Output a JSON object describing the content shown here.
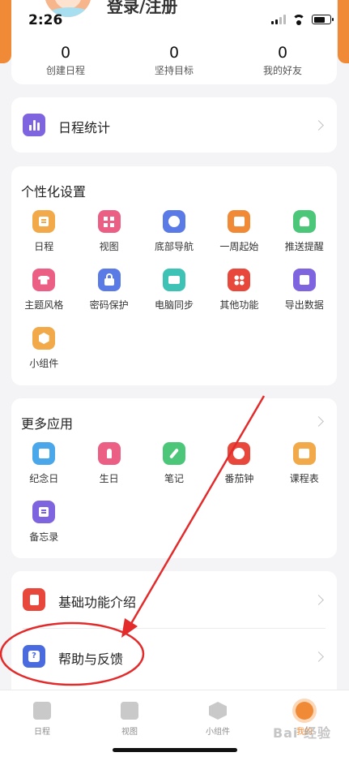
{
  "status": {
    "time": "2:26"
  },
  "profile": {
    "login_label": "登录/注册"
  },
  "stats": [
    {
      "value": "0",
      "label": "创建日程"
    },
    {
      "value": "0",
      "label": "坚持目标"
    },
    {
      "value": "0",
      "label": "我的好友"
    }
  ],
  "schedule_stats": {
    "label": "日程统计"
  },
  "personal": {
    "title": "个性化设置",
    "items": [
      {
        "label": "日程",
        "icon": "schedule-icon",
        "color": "#f2a94a"
      },
      {
        "label": "视图",
        "icon": "grid-icon",
        "color": "#ec5f84"
      },
      {
        "label": "底部导航",
        "icon": "compass-icon",
        "color": "#5a7be6"
      },
      {
        "label": "一周起始",
        "icon": "calendar-icon",
        "color": "#f08a36"
      },
      {
        "label": "推送提醒",
        "icon": "bell-icon",
        "color": "#4cc779"
      },
      {
        "label": "主题风格",
        "icon": "shirt-icon",
        "color": "#ec5f84"
      },
      {
        "label": "密码保护",
        "icon": "lock-icon",
        "color": "#5a7be6"
      },
      {
        "label": "电脑同步",
        "icon": "screen-icon",
        "color": "#3fc2b6"
      },
      {
        "label": "其他功能",
        "icon": "apps-icon",
        "color": "#e8483c"
      },
      {
        "label": "导出数据",
        "icon": "export-icon",
        "color": "#7f64e0"
      },
      {
        "label": "小组件",
        "icon": "widget-icon",
        "color": "#f2a94a"
      }
    ]
  },
  "more_apps": {
    "title": "更多应用",
    "items": [
      {
        "label": "纪念日",
        "icon": "anniversary-icon",
        "color": "#4aa7ea"
      },
      {
        "label": "生日",
        "icon": "candle-icon",
        "color": "#ec5f84"
      },
      {
        "label": "笔记",
        "icon": "pen-icon",
        "color": "#4cc779"
      },
      {
        "label": "番茄钟",
        "icon": "tomato-icon",
        "color": "#e8483c"
      },
      {
        "label": "课程表",
        "icon": "timetable-icon",
        "color": "#f2a94a"
      },
      {
        "label": "备忘录",
        "icon": "memo-icon",
        "color": "#7f64e0"
      }
    ]
  },
  "basic_intro": {
    "label": "基础功能介绍"
  },
  "help": {
    "label": "帮助与反馈"
  },
  "tabs": [
    {
      "label": "日程"
    },
    {
      "label": "视图"
    },
    {
      "label": "小组件"
    },
    {
      "label": "我的"
    }
  ],
  "watermark": "Bai 经验",
  "colors": {
    "accent": "#f08a36",
    "annotation": "#e32b2b",
    "stats_icon": "#7f64e0",
    "intro_icon": "#e8483c",
    "help_icon": "#4a6be0"
  }
}
